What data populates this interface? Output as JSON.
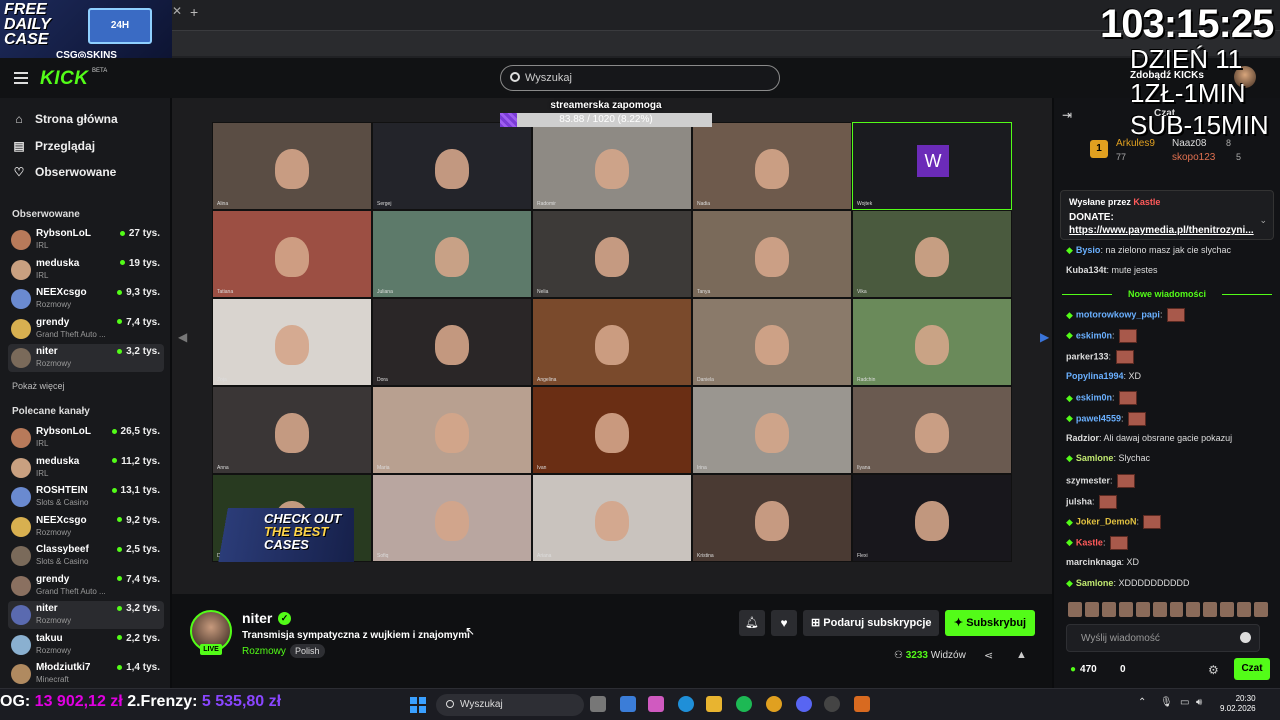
{
  "promo": {
    "title": "FREE DAILY CASE",
    "case_label": "24H",
    "brand": "CSG◎SKINS"
  },
  "header": {
    "logo": "KICK",
    "beta": "BETA",
    "search_placeholder": "Wyszukaj",
    "kicks_label": "Zdobądź KICKs"
  },
  "sidebar": {
    "nav": [
      {
        "label": "Strona główna",
        "icon": "home-icon"
      },
      {
        "label": "Przeglądaj",
        "icon": "browse-icon"
      },
      {
        "label": "Obserwowane",
        "icon": "heart-icon"
      }
    ],
    "followed_title": "Obserwowane",
    "followed": [
      {
        "name": "RybsonLoL",
        "category": "IRL",
        "viewers": "27 tys."
      },
      {
        "name": "meduska",
        "category": "IRL",
        "viewers": "19 tys."
      },
      {
        "name": "NEEXcsgo",
        "category": "Rozmowy",
        "viewers": "9,3 tys."
      },
      {
        "name": "grendy",
        "category": "Grand Theft Auto ...",
        "viewers": "7,4 tys."
      },
      {
        "name": "niter",
        "category": "Rozmowy",
        "viewers": "3,2 tys."
      }
    ],
    "show_more": "Pokaż więcej",
    "recommended_title": "Polecane kanały",
    "recommended": [
      {
        "name": "RybsonLoL",
        "category": "IRL",
        "viewers": "26,5 tys."
      },
      {
        "name": "meduska",
        "category": "IRL",
        "viewers": "11,2 tys."
      },
      {
        "name": "ROSHTEIN",
        "category": "Slots & Casino",
        "viewers": "13,1 tys."
      },
      {
        "name": "NEEXcsgo",
        "category": "Rozmowy",
        "viewers": "9,2 tys."
      },
      {
        "name": "Classybeef",
        "category": "Slots & Casino",
        "viewers": "2,5 tys."
      },
      {
        "name": "grendy",
        "category": "Grand Theft Auto ...",
        "viewers": "7,4 tys."
      },
      {
        "name": "niter",
        "category": "Rozmowy",
        "viewers": "3,2 tys."
      },
      {
        "name": "takuu",
        "category": "Rozmowy",
        "viewers": "2,2 tys."
      },
      {
        "name": "Młodziutki7",
        "category": "Minecraft",
        "viewers": "1,4 tys."
      }
    ]
  },
  "video": {
    "goal_title": "streamerska zapomoga",
    "goal_text": "83.88 / 1020 (8.22%)",
    "goal_fraction": 0.0822,
    "tile_letter": "W",
    "ad_line1": "CHECK OUT",
    "ad_line2": "THE BEST",
    "ad_line3": "CASES",
    "tiles": [
      {
        "name": "Alina",
        "bg": "#5a4d44"
      },
      {
        "name": "Sergej",
        "bg": "#23242a"
      },
      {
        "name": "Radomir",
        "bg": "#8e8a84"
      },
      {
        "name": "Nadia",
        "bg": "#6e5a4c"
      },
      {
        "name": "Wojtek",
        "bg": "#1a1b1f"
      },
      {
        "name": "Tatiana",
        "bg": "#9c4f43"
      },
      {
        "name": "Juliana",
        "bg": "#5d7a6a"
      },
      {
        "name": "Nelia",
        "bg": "#3d3a38"
      },
      {
        "name": "Tanya",
        "bg": "#7a6a5a"
      },
      {
        "name": "Vika",
        "bg": "#4a5a3e"
      },
      {
        "name": "Zoja",
        "bg": "#d9d4cf"
      },
      {
        "name": "Dora",
        "bg": "#2a2627"
      },
      {
        "name": "Angelina",
        "bg": "#7a4a2c"
      },
      {
        "name": "Daniela",
        "bg": "#8a7a6a"
      },
      {
        "name": "Radchin",
        "bg": "#6a8a5a"
      },
      {
        "name": "Anna",
        "bg": "#3a3636"
      },
      {
        "name": "Maria",
        "bg": "#b8a090"
      },
      {
        "name": "Ivan",
        "bg": "#6a2e14"
      },
      {
        "name": "Irina",
        "bg": "#9a9690"
      },
      {
        "name": "Ilyana",
        "bg": "#6a5a50"
      },
      {
        "name": "Didi",
        "bg": "#283a20"
      },
      {
        "name": "Sofiq",
        "bg": "#b9a6a0"
      },
      {
        "name": "Ariana",
        "bg": "#c9c3be"
      },
      {
        "name": "Kristina",
        "bg": "#4a3a33"
      },
      {
        "name": "Flexi",
        "bg": "#18171c"
      }
    ]
  },
  "stream": {
    "name": "niter",
    "title": "Transmisja sympatyczna z wujkiem i znajomymi",
    "category": "Rozmowy",
    "language": "Polish",
    "live": "LIVE",
    "gift_label": "Podaruj subskrypcje",
    "subscribe_label": "Subskrybuj",
    "viewers_count": "3233",
    "viewers_label": "Widzów"
  },
  "chat": {
    "title": "Czat",
    "leaderboard": [
      {
        "name": "Arkules9",
        "score": "77"
      },
      {
        "name": "Naaz08",
        "score": "8"
      },
      {
        "name": "skopo123",
        "score": "5"
      }
    ],
    "pinned_by": "Wysłane przez",
    "pinned_user": "Kastle",
    "pinned_label": "DONATE:",
    "pinned_link": "https://www.paymedia.pl/thenitrozyni...",
    "new_messages": "Nowe wiadomości",
    "messages": [
      {
        "user": "Bysio",
        "color": "#6ab0ff",
        "text": "na zielono masz jak cie slychac",
        "badge": true,
        "emote": false
      },
      {
        "user": "Kuba134t",
        "color": "#ddd",
        "text": "mute jestes",
        "badge": false,
        "emote": false
      },
      {
        "user": "motorowkowy_papi",
        "color": "#6ab0ff",
        "text": "",
        "badge": true,
        "emote": true
      },
      {
        "user": "eskim0n",
        "color": "#6ab0ff",
        "text": "",
        "badge": true,
        "emote": true
      },
      {
        "user": "parker133",
        "color": "#ddd",
        "text": "",
        "badge": false,
        "emote": true
      },
      {
        "user": "Popylina1994",
        "color": "#6ab0ff",
        "text": "XD",
        "badge": false,
        "emote": false
      },
      {
        "user": "eskim0n",
        "color": "#6ab0ff",
        "text": "",
        "badge": true,
        "emote": true
      },
      {
        "user": "pawel4559",
        "color": "#6ab0ff",
        "text": "",
        "badge": true,
        "emote": true
      },
      {
        "user": "Radzior",
        "color": "#ddd",
        "text": "Ali dawaj obsrane gacie pokazuj",
        "badge": false,
        "emote": false
      },
      {
        "user": "Samlone",
        "color": "#c0e870",
        "text": "Slychac",
        "badge": true,
        "emote": false
      },
      {
        "user": "szymester",
        "color": "#ddd",
        "text": "",
        "badge": false,
        "emote": true
      },
      {
        "user": "julsha",
        "color": "#ddd",
        "text": "",
        "badge": false,
        "emote": true
      },
      {
        "user": "Joker_DemoN",
        "color": "#e0c040",
        "text": "",
        "badge": true,
        "emote": true
      },
      {
        "user": "Kastle",
        "color": "#ff5a5a",
        "text": "",
        "badge": true,
        "emote": true
      },
      {
        "user": "marcinknaga",
        "color": "#ddd",
        "text": "XD",
        "badge": false,
        "emote": false
      },
      {
        "user": "Samlone",
        "color": "#c0e870",
        "text": "XDDDDDDDDDD",
        "badge": true,
        "emote": false
      }
    ],
    "input_placeholder": "Wyślij wiadomość",
    "points": "470",
    "gifts": "0",
    "send_label": "Czat"
  },
  "overlay": {
    "timer": "103:15:25",
    "day": "DZIEŃ 11",
    "rate1": "1ZŁ-1MIN",
    "rate2": "SUB-15MIN"
  },
  "taskbar": {
    "ticker_prefix": "OG:",
    "ticker_value1": "13 902,12 zł",
    "ticker_label2": "2.Frenzy:",
    "ticker_value2": "5 535,80 zł",
    "search_placeholder": "Wyszukaj",
    "time": "20:30",
    "date": "9.02.2026"
  }
}
